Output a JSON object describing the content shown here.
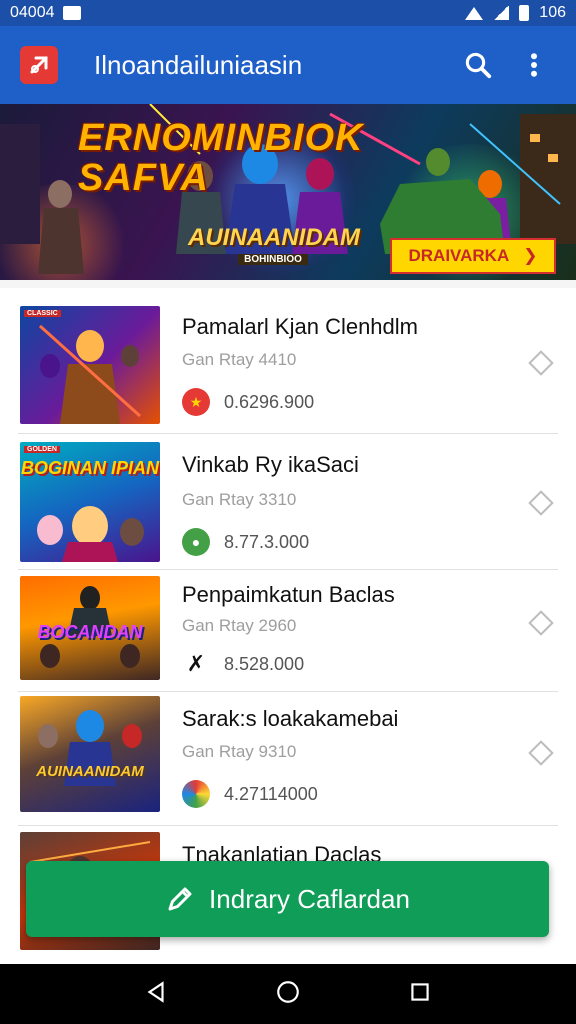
{
  "status_bar": {
    "time": "04004",
    "time_extra": "106"
  },
  "app_bar": {
    "title": "Ilnoandailuniaasin",
    "logo_icon": "app-logo-icon",
    "search_icon": "search-icon",
    "more_icon": "more-vert-icon"
  },
  "banner": {
    "title": "ERNOMINBIOK SAFVA",
    "subtitle": "AUINAANIDAM",
    "caption": "BOHINBIOO",
    "cta_label": "DRAIVARKA",
    "cta_icon": "chevron-right-icon"
  },
  "list": {
    "items": [
      {
        "title": "Pamalarl Kjan Clenhdlm",
        "subtitle": "Gan Rtay 4410",
        "value": "0.6296.900",
        "badge": "CLASSIC",
        "thumb_text": "",
        "meta_icon": "red-emblem-icon"
      },
      {
        "title": "Vinkab Ry ikaSaci",
        "subtitle": "Gan Rtay 3310",
        "value": "8.77.3.000",
        "badge": "GOLDEN",
        "thumb_text": "BOGINAN IPIAN",
        "meta_icon": "green-emblem-icon"
      },
      {
        "title": "Penpaimkatun Baclas",
        "subtitle": "Gan Rtay 2960",
        "value": "8.528.000",
        "badge": "",
        "thumb_text": "BOCANDAN",
        "meta_icon": "cross-emblem-icon"
      },
      {
        "title": "Sarak:s loakakamebai",
        "subtitle": "Gan Rtay 9310",
        "value": "4.27114000",
        "badge": "",
        "thumb_text": "AUINAANIDAM",
        "meta_icon": "colorful-emblem-icon"
      },
      {
        "title": "Tnakanlatian Daclas",
        "subtitle": "",
        "value": "",
        "badge": "",
        "thumb_text": "",
        "meta_icon": ""
      }
    ]
  },
  "fab": {
    "label": "Indrary Caflardan",
    "icon": "pencil-icon"
  },
  "navbar": {
    "back_icon": "back-icon",
    "home_icon": "home-icon",
    "recents_icon": "recents-icon"
  },
  "colors": {
    "primary": "#1f5fc8",
    "status": "#1b4fa8",
    "fab": "#0f9d58",
    "accent": "#ffd600"
  }
}
